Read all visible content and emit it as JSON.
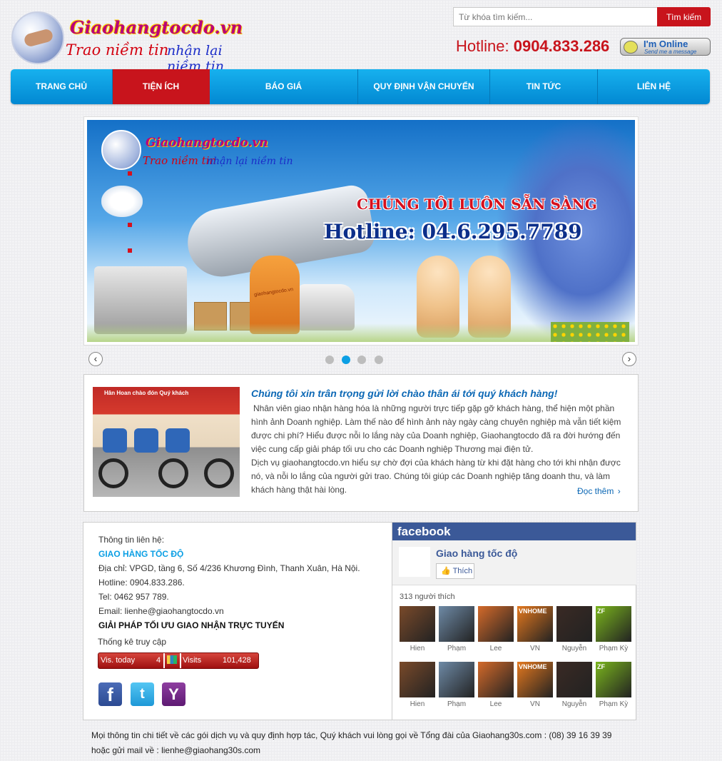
{
  "header": {
    "logo_name": "Giaohangtocdo.vn",
    "slogan_part1": "Trao niềm tin",
    "slogan_part2": "nhận lại niềm tin",
    "search_placeholder": "Từ khóa tìm kiếm...",
    "search_button": "Tìm kiếm",
    "hotline_label": "Hotline:",
    "hotline_number": "0904.833.286",
    "online_title": "I'm Online",
    "online_sub": "Send me a message"
  },
  "nav": {
    "items": [
      {
        "label": "TRANG CHỦ"
      },
      {
        "label": "TIỆN ÍCH"
      },
      {
        "label": "BÁO GIÁ"
      },
      {
        "label": "QUY ĐỊNH VẬN CHUYỂN"
      },
      {
        "label": "TIN TỨC"
      },
      {
        "label": "LIÊN HỆ"
      }
    ],
    "active_index": 1
  },
  "banner": {
    "logo_name": "Giaohangtocdo.vn",
    "slogan_part1": "Trao niềm tin",
    "slogan_part2": "nhận lại niềm tin",
    "headline": "CHÚNG TÔI LUÔN SẴN SÀNG",
    "hotline": "Hotline: 04.6.295.7789",
    "box_text": "giaohangtocdo.vn",
    "slide_count": 4,
    "active_slide": 2,
    "prev_icon": "chevron-left-icon",
    "next_icon": "chevron-right-icon"
  },
  "intro": {
    "photo_sign": "Hân Hoan chào đón Quý khách",
    "title": "Chúng tôi xin trân trọng gửi lời chào thân ái tới quý khách hàng!",
    "body": "Nhân viên giao nhận hàng hóa là những người trực tiếp gặp gỡ khách hàng, thể hiện một phần hình ảnh Doanh nghiệp. Làm thế nào để hình ảnh này ngày càng chuyên nghiệp mà vẫn tiết kiệm được chi phí? Hiểu được nỗi lo lắng này của Doanh nghiệp, Giaohangtocdo đã ra đời hướng đến việc cung cấp giải pháp tối ưu cho các Doanh nghiệp Thương mại điện tử.",
    "body2": "Dịch vụ giaohangtocdo.vn hiểu sự chờ đợi của khách hàng từ khi đặt hàng cho tới khi nhận được nó, và nỗi lo lắng của người gửi trao. Chúng tôi giúp các Doanh nghiệp tăng doanh thu, và làm khách hàng thật hài lòng.",
    "read_more": "Đọc thêm"
  },
  "contact": {
    "heading": "Thông tin liên hệ:",
    "company": "GIAO HÀNG TỐC ĐỘ",
    "address": "Địa chỉ: VPGD, tầng 6, Số 4/236 Khương Đình, Thanh Xuân, Hà Nội.",
    "hotline": "Hotline: 0904.833.286.",
    "tel": "Tel: 0462 957 789.",
    "email": "Email: lienhe@giaohangtocdo.vn",
    "solution": "GIẢI PHÁP TỐI ƯU GIAO NHẬN TRỰC TUYẾN"
  },
  "stats": {
    "title": "Thống kê truy cập",
    "today_label": "Vis. today",
    "today_value": "4",
    "visits_label": "Visits",
    "visits_value": "101,428"
  },
  "social": [
    {
      "name": "facebook-icon",
      "glyph": "f"
    },
    {
      "name": "twitter-icon",
      "glyph": "t"
    },
    {
      "name": "yahoo-icon",
      "glyph": "Y"
    }
  ],
  "facebook": {
    "brand": "facebook",
    "page_name": "Giao hàng tốc độ",
    "like_button": "Thích",
    "likes": "313 người thích",
    "fans": [
      {
        "name": "Hien",
        "color": "#7a4a2a"
      },
      {
        "name": "Phạm",
        "color": "#6e8aa6"
      },
      {
        "name": "Lee",
        "color": "#d46a2a"
      },
      {
        "name": "VN",
        "color": "#e4781e",
        "caption": "VNHOME"
      },
      {
        "name": "Nguyễn",
        "color": "#3a2a24"
      },
      {
        "name": "Phạm Kỳ",
        "color": "#7ab51d",
        "caption": "ZF"
      },
      {
        "name": "Hien",
        "color": "#7a4a2a"
      },
      {
        "name": "Phạm",
        "color": "#6e8aa6"
      },
      {
        "name": "Lee",
        "color": "#d46a2a"
      },
      {
        "name": "VN",
        "color": "#e4781e",
        "caption": "VNHOME"
      },
      {
        "name": "Nguyễn",
        "color": "#3a2a24"
      },
      {
        "name": "Phạm Kỳ",
        "color": "#7ab51d",
        "caption": "ZF"
      }
    ]
  },
  "footer": {
    "line1": "Mọi thông tin chi tiết về các gói dịch vụ và quy định hợp tác, Quý khách vui lòng gọi về Tổng đài của Giaohang30s.com : (08) 39 16 39 39",
    "line2": "hoặc gửi mail về : lienhe@giaohang30s.com"
  },
  "colors": {
    "brand_red": "#c8141c",
    "nav_blue": "#0ea3e8",
    "link_blue": "#0c68b5",
    "facebook_blue": "#3b5998"
  }
}
